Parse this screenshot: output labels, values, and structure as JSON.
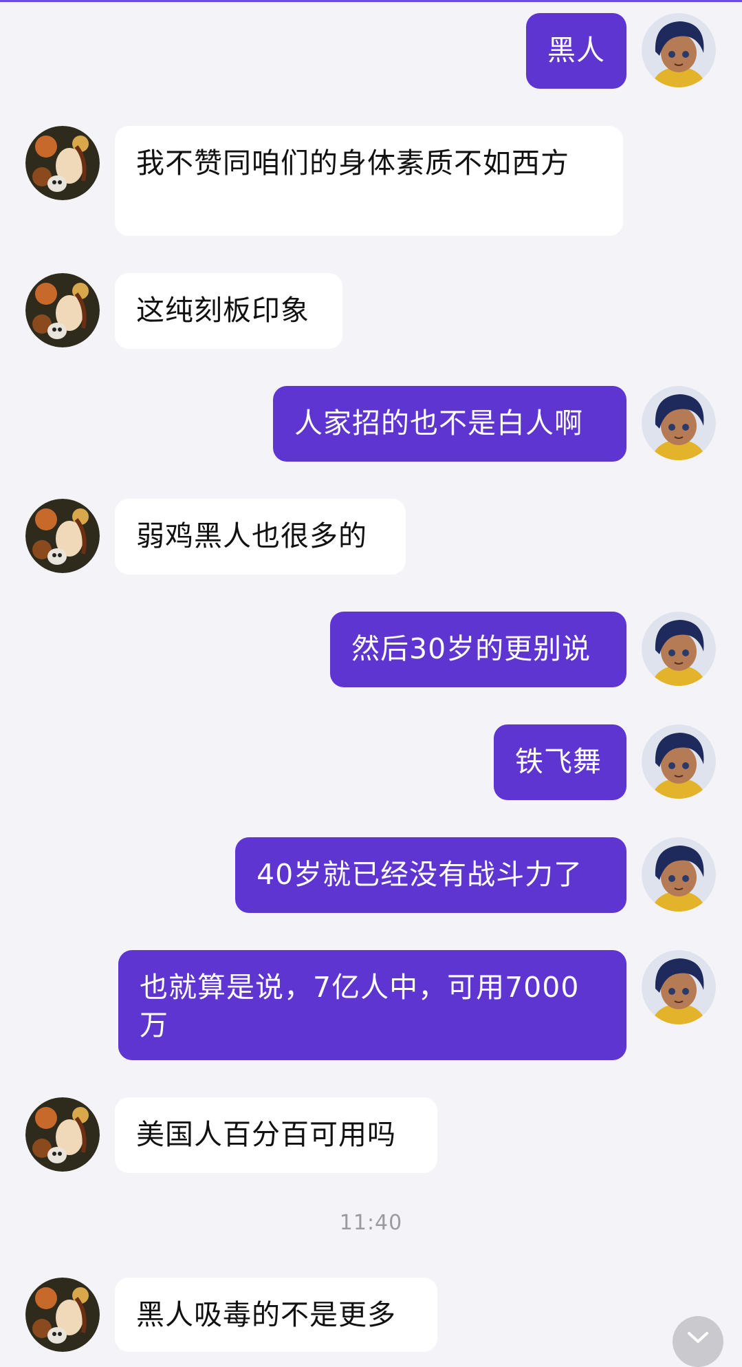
{
  "chat": {
    "messages": [
      {
        "side": "right",
        "text": "黑人",
        "avatar": "user-avatar-anime-boy"
      },
      {
        "side": "left",
        "text": "我不赞同咱们的身体素质不如西方",
        "avatar": "contact-avatar-illustration"
      },
      {
        "side": "left",
        "text": "这纯刻板印象",
        "avatar": "contact-avatar-illustration"
      },
      {
        "side": "right",
        "text": "人家招的也不是白人啊",
        "avatar": "user-avatar-anime-boy"
      },
      {
        "side": "left",
        "text": "弱鸡黑人也很多的",
        "avatar": "contact-avatar-illustration"
      },
      {
        "side": "right",
        "text": "然后30岁的更别说",
        "avatar": "user-avatar-anime-boy"
      },
      {
        "side": "right",
        "text": "铁飞舞",
        "avatar": "user-avatar-anime-boy"
      },
      {
        "side": "right",
        "text": "40岁就已经没有战斗力了",
        "avatar": "user-avatar-anime-boy"
      },
      {
        "side": "right",
        "text": "也就算是说，7亿人中，可用7000万",
        "avatar": "user-avatar-anime-boy"
      },
      {
        "side": "left",
        "text": "美国人百分百可用吗",
        "avatar": "contact-avatar-illustration"
      },
      {
        "side": "left",
        "text": "黑人吸毒的不是更多",
        "avatar": "contact-avatar-illustration"
      }
    ],
    "timestamp": "11:40"
  },
  "colors": {
    "background": "#f4f4f8",
    "outgoing_bubble": "#5f35d2",
    "incoming_bubble": "#ffffff",
    "timestamp_text": "#9a9aa0"
  },
  "icons": {
    "scroll_down": "chevron-down-icon"
  }
}
